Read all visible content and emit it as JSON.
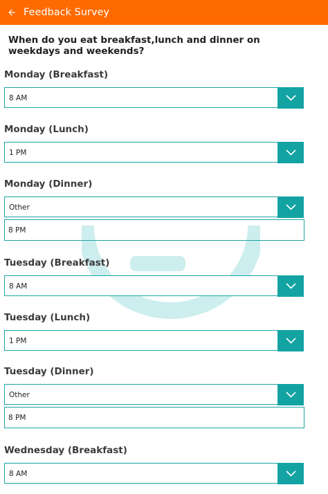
{
  "app_bar": {
    "title": "Feedback Survey",
    "icon": "back-arrow-icon",
    "background": "#ff6a00"
  },
  "question": "When do you eat breakfast,lunch and dinner on weekdays and weekends?",
  "accent_color": "#14a3a3",
  "fields": [
    {
      "label": "Monday (Breakfast)",
      "selected": "8 AM",
      "other_text": null
    },
    {
      "label": "Monday (Lunch)",
      "selected": "1 PM",
      "other_text": null
    },
    {
      "label": "Monday (Dinner)",
      "selected": "Other",
      "other_text": "8 PM"
    },
    {
      "label": "Tuesday (Breakfast)",
      "selected": "8 AM",
      "other_text": null
    },
    {
      "label": "Tuesday (Lunch)",
      "selected": "1 PM",
      "other_text": null
    },
    {
      "label": "Tuesday (Dinner)",
      "selected": "Other",
      "other_text": "8 PM"
    },
    {
      "label": "Wednesday (Breakfast)",
      "selected": "8 AM",
      "other_text": null
    }
  ]
}
